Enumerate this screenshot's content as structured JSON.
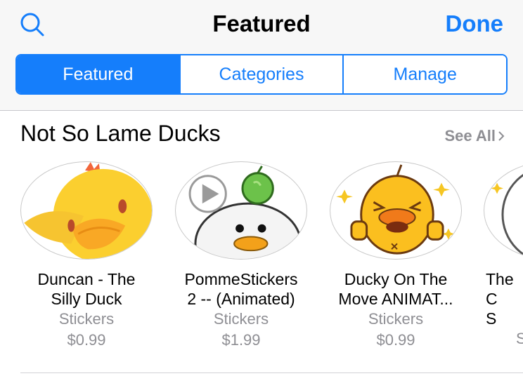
{
  "header": {
    "title": "Featured",
    "done_label": "Done",
    "search_icon": "search-icon",
    "tabs": [
      {
        "label": "Featured",
        "active": true
      },
      {
        "label": "Categories",
        "active": false
      },
      {
        "label": "Manage",
        "active": false
      }
    ]
  },
  "section": {
    "title": "Not So Lame Ducks",
    "see_all_label": "See All"
  },
  "items": [
    {
      "name": "Duncan - The\nSilly Duck",
      "kind": "Stickers",
      "price": "$0.99",
      "icon": "yellow-duck-icon"
    },
    {
      "name": "PommeStickers\n2 -- (Animated)",
      "kind": "Stickers",
      "price": "$1.99",
      "icon": "white-bird-apple-icon"
    },
    {
      "name": "Ducky On The\nMove ANIMAT...",
      "kind": "Stickers",
      "price": "$0.99",
      "icon": "thumbs-up-duck-icon"
    },
    {
      "name": "The C\nS",
      "kind": "S",
      "price": "",
      "icon": "sticker-icon"
    }
  ],
  "colors": {
    "accent": "#157efb",
    "secondary_text": "#8e8e93"
  }
}
